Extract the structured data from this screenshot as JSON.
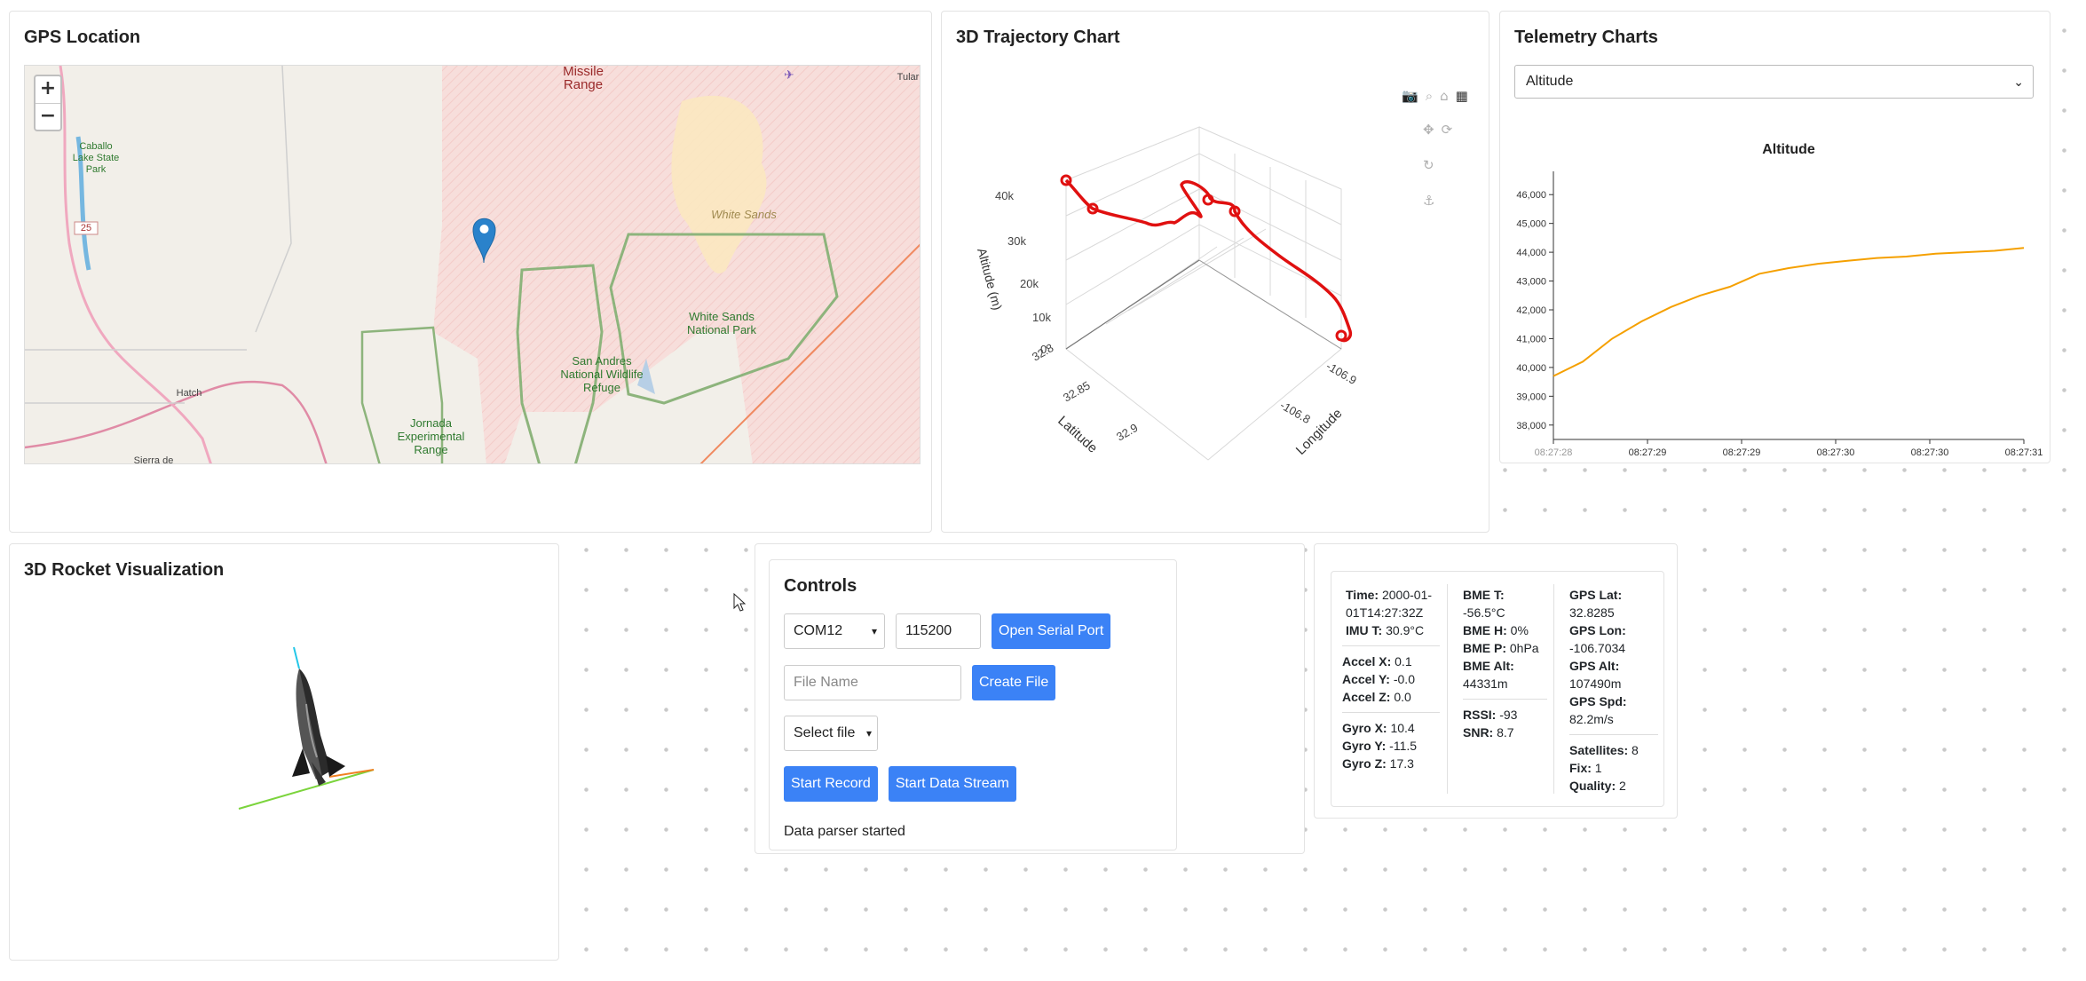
{
  "gps": {
    "title": "GPS Location",
    "zoom_in": "+",
    "zoom_out": "−",
    "labels": [
      "Missile Range",
      "White Sands",
      "White Sands National Park",
      "San Andres National Wildlife Refuge",
      "Jornada Experimental Range",
      "Caballo Lake State Park",
      "Hatch",
      "Sierra de",
      "Tular",
      "25"
    ]
  },
  "trajectory": {
    "title": "3D Trajectory Chart",
    "altitude_label": "Altitude (m)",
    "latitude_label": "Latitude",
    "longitude_label": "Longitude",
    "alt_ticks": [
      "40k",
      "30k",
      "20k",
      "10k",
      "0"
    ],
    "lat_ticks": [
      "32.8",
      "32.85",
      "32.9"
    ],
    "lon_ticks": [
      "-106.9",
      "-106.8"
    ],
    "modebar_top": [
      "camera-icon",
      "zoom-icon",
      "home-icon",
      "plotly-logo"
    ],
    "modebar_mid": [
      "pan-icon",
      "orbit-icon"
    ],
    "modebar_rot": "turntable-icon",
    "modebar_anchor": "anchor-icon"
  },
  "telemetry": {
    "title": "Telemetry Charts",
    "selected": "Altitude",
    "chart_data": {
      "type": "line",
      "title": "Altitude",
      "color": "#f5a000",
      "x": [
        "08:27:28",
        "08:27:29",
        "08:27:29",
        "08:27:30",
        "08:27:30",
        "08:27:31"
      ],
      "ylim": [
        37500,
        46500
      ],
      "yticks": [
        "46,000",
        "45,000",
        "44,000",
        "43,000",
        "42,000",
        "41,000",
        "40,000",
        "39,000",
        "38,000"
      ],
      "values": [
        39700,
        40200,
        41000,
        41600,
        42100,
        42500,
        42800,
        43250,
        43450,
        43600,
        43700,
        43800,
        43850,
        43950,
        44000,
        44050,
        44150
      ]
    }
  },
  "rocket": {
    "title": "3D Rocket Visualization"
  },
  "controls": {
    "title": "Controls",
    "port": "COM12",
    "baud": "115200",
    "open_port": "Open Serial Port",
    "file_placeholder": "File Name",
    "create_file": "Create File",
    "select_file": "Select file",
    "start_record": "Start Record",
    "start_stream": "Start Data Stream",
    "status": "Data parser started"
  },
  "readout": {
    "time_k": "Time:",
    "time_v": " 2000-01-01T14:27:32Z",
    "imu_t_k": "IMU T:",
    "imu_t_v": " 30.9°C",
    "ax_k": "Accel X:",
    "ax_v": " 0.1",
    "ay_k": "Accel Y:",
    "ay_v": " -0.0",
    "az_k": "Accel Z:",
    "az_v": " 0.0",
    "gx_k": "Gyro X:",
    "gx_v": " 10.4",
    "gy_k": "Gyro Y:",
    "gy_v": " -11.5",
    "gz_k": "Gyro Z:",
    "gz_v": " 17.3",
    "bme_t_k": "BME T:",
    "bme_t_v": " -56.5°C",
    "bme_h_k": "BME H:",
    "bme_h_v": " 0%",
    "bme_p_k": "BME P:",
    "bme_p_v": " 0hPa",
    "bme_alt_k": "BME Alt:",
    "bme_alt_v": " 44331m",
    "rssi_k": "RSSI:",
    "rssi_v": " -93",
    "snr_k": "SNR:",
    "snr_v": " 8.7",
    "gps_lat_k": "GPS Lat:",
    "gps_lat_v": " 32.8285",
    "gps_lon_k": "GPS Lon:",
    "gps_lon_v": " -106.7034",
    "gps_alt_k": "GPS Alt:",
    "gps_alt_v": " 107490m",
    "gps_spd_k": "GPS Spd:",
    "gps_spd_v": " 82.2m/s",
    "sats_k": "Satellites:",
    "sats_v": " 8",
    "fix_k": "Fix:",
    "fix_v": " 1",
    "qual_k": "Quality:",
    "qual_v": " 2"
  }
}
